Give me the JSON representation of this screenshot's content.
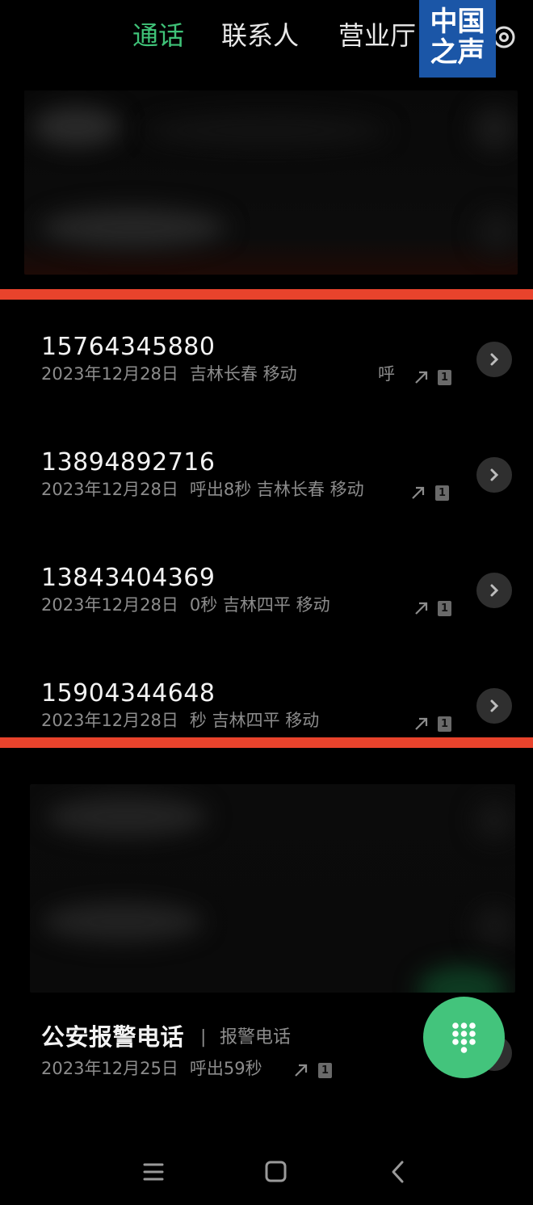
{
  "tabs": [
    {
      "label": "通话",
      "active": true
    },
    {
      "label": "联系人",
      "active": false
    },
    {
      "label": "营业厅",
      "active": false
    }
  ],
  "watermark": {
    "line1": "中国",
    "line2": "之声"
  },
  "calls": [
    {
      "number": "15764345880",
      "date": "2023年12月28日",
      "info": "吉林长春 移动",
      "extra": "呼",
      "sim": "1"
    },
    {
      "number": "13894892716",
      "date": "2023年12月28日",
      "info": "呼出8秒  吉林长春  移动",
      "sim": "1"
    },
    {
      "number": "13843404369",
      "date": "2023年12月28日",
      "info": "0秒  吉林四平  移动",
      "sim": "1"
    },
    {
      "number": "15904344648",
      "date": "2023年12月28日",
      "info": "秒  吉林四平  移动",
      "sim": "1"
    }
  ],
  "police_call": {
    "name": "公安报警电话",
    "separator": "|",
    "tag": "报警电话",
    "date": "2023年12月25日",
    "info": "呼出59秒",
    "sim": "1"
  },
  "icons": {
    "settings": "gear-icon",
    "detail": "chevron-right-icon",
    "outgoing": "outgoing-arrow-icon",
    "dialpad": "dialpad-icon",
    "nav_menu": "menu-icon",
    "nav_home": "home-icon",
    "nav_back": "back-icon"
  },
  "colors": {
    "accent": "#3fc278",
    "fab": "#43c47c",
    "highlight_line": "#e8432c",
    "watermark_bg": "#1b56a7"
  }
}
